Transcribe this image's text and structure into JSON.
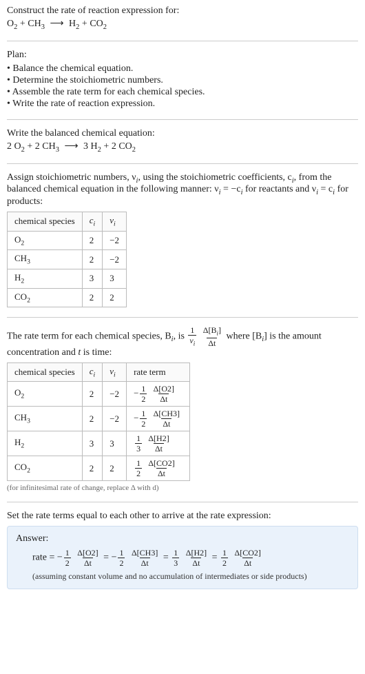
{
  "header": {
    "prompt": "Construct the rate of reaction expression for:",
    "equation_lhs_1": "O",
    "equation_lhs_1_sub": "2",
    "plus1": " + CH",
    "equation_lhs_2_sub": "3",
    "arrow": "⟶",
    "equation_rhs_1": "H",
    "equation_rhs_1_sub": "2",
    "plus2": " + CO",
    "equation_rhs_2_sub": "2"
  },
  "plan": {
    "title": "Plan:",
    "items": [
      "Balance the chemical equation.",
      "Determine the stoichiometric numbers.",
      "Assemble the rate term for each chemical species.",
      "Write the rate of reaction expression."
    ]
  },
  "balanced": {
    "title": "Write the balanced chemical equation:",
    "c1": "2 O",
    "c1sub": "2",
    "c2": " + 2 CH",
    "c2sub": "3",
    "arrow": "⟶",
    "c3": "3 H",
    "c3sub": "2",
    "c4": " + 2 CO",
    "c4sub": "2"
  },
  "stoich": {
    "intro_a": "Assign stoichiometric numbers, ν",
    "intro_a_sub": "i",
    "intro_b": ", using the stoichiometric coefficients, c",
    "intro_b_sub": "i",
    "intro_c": ", from the balanced chemical equation in the following manner: ν",
    "intro_c_sub": "i",
    "intro_d": " = −c",
    "intro_d_sub": "i",
    "intro_e": " for reactants and ν",
    "intro_e_sub": "i",
    "intro_f": " = c",
    "intro_f_sub": "i",
    "intro_g": " for products:",
    "headers": {
      "species": "chemical species",
      "ci": "c",
      "ci_sub": "i",
      "vi": "ν",
      "vi_sub": "i"
    },
    "rows": [
      {
        "species": "O",
        "species_sub": "2",
        "ci": "2",
        "vi": "−2"
      },
      {
        "species": "CH",
        "species_sub": "3",
        "ci": "2",
        "vi": "−2"
      },
      {
        "species": "H",
        "species_sub": "2",
        "ci": "3",
        "vi": "3"
      },
      {
        "species": "CO",
        "species_sub": "2",
        "ci": "2",
        "vi": "2"
      }
    ]
  },
  "rateterm": {
    "intro_a": "The rate term for each chemical species, B",
    "intro_a_sub": "i",
    "intro_b": ", is ",
    "frac1_num": "1",
    "frac1_den_a": "ν",
    "frac1_den_sub": "i",
    "frac2_num_a": "Δ[B",
    "frac2_num_sub": "i",
    "frac2_num_b": "]",
    "frac2_den": "Δt",
    "intro_c": " where [B",
    "intro_c_sub": "i",
    "intro_d": "] is the amount concentration and ",
    "tvar": "t",
    "intro_e": " is time:",
    "headers": {
      "species": "chemical species",
      "ci": "c",
      "ci_sub": "i",
      "vi": "ν",
      "vi_sub": "i",
      "rate": "rate term"
    },
    "rows": [
      {
        "species": "O",
        "species_sub": "2",
        "ci": "2",
        "vi": "−2",
        "sign": "−",
        "fnum": "1",
        "fden": "2",
        "dnum": "Δ[O2]",
        "dden": "Δt"
      },
      {
        "species": "CH",
        "species_sub": "3",
        "ci": "2",
        "vi": "−2",
        "sign": "−",
        "fnum": "1",
        "fden": "2",
        "dnum": "Δ[CH3]",
        "dden": "Δt"
      },
      {
        "species": "H",
        "species_sub": "2",
        "ci": "3",
        "vi": "3",
        "sign": "",
        "fnum": "1",
        "fden": "3",
        "dnum": "Δ[H2]",
        "dden": "Δt"
      },
      {
        "species": "CO",
        "species_sub": "2",
        "ci": "2",
        "vi": "2",
        "sign": "",
        "fnum": "1",
        "fden": "2",
        "dnum": "Δ[CO2]",
        "dden": "Δt"
      }
    ],
    "note": "(for infinitesimal rate of change, replace Δ with d)"
  },
  "final": {
    "intro": "Set the rate terms equal to each other to arrive at the rate expression:",
    "answer_label": "Answer:",
    "rate_word": "rate = ",
    "terms": [
      {
        "sign": "−",
        "fnum": "1",
        "fden": "2",
        "dnum": "Δ[O2]",
        "dden": "Δt"
      },
      {
        "sign": "−",
        "fnum": "1",
        "fden": "2",
        "dnum": "Δ[CH3]",
        "dden": "Δt"
      },
      {
        "sign": "",
        "fnum": "1",
        "fden": "3",
        "dnum": "Δ[H2]",
        "dden": "Δt"
      },
      {
        "sign": "",
        "fnum": "1",
        "fden": "2",
        "dnum": "Δ[CO2]",
        "dden": "Δt"
      }
    ],
    "eq": " = ",
    "assume": "(assuming constant volume and no accumulation of intermediates or side products)"
  }
}
